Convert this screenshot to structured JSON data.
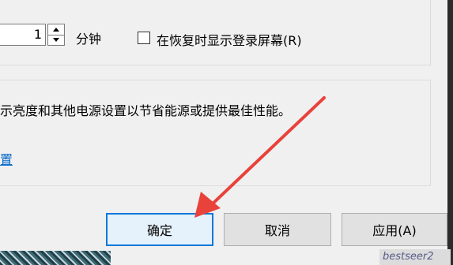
{
  "timeout": {
    "value": "1",
    "unit": "分钟"
  },
  "resume_option": {
    "label": "在恢复时显示登录屏幕(R)",
    "checked": false
  },
  "power_section": {
    "description": "示亮度和其他电源设置以节省能源或提供最佳性能。",
    "link_text": "置"
  },
  "buttons": {
    "ok": "确定",
    "cancel": "取消",
    "apply": "应用(A)"
  },
  "watermark_text": "bestseer2",
  "colors": {
    "arrow": "#e8423b",
    "link": "#0066cc",
    "primary_border": "#0078d7"
  }
}
